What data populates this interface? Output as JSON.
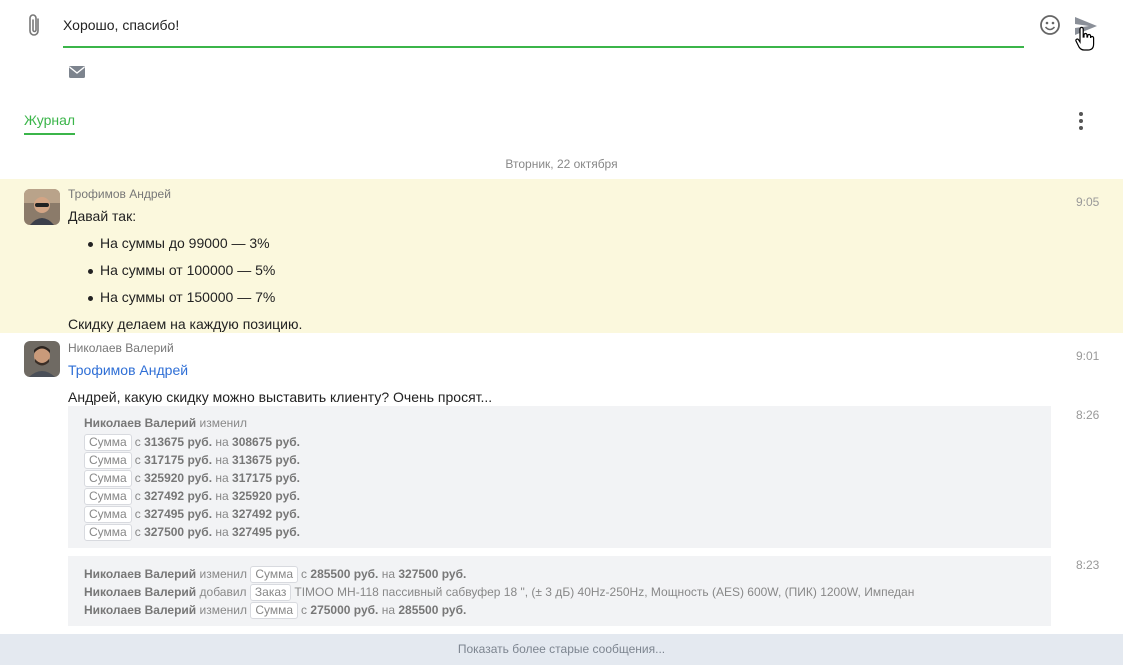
{
  "composer": {
    "input_value": "Хорошо, спасибо!",
    "attach_icon": "paperclip-icon",
    "emoji_icon": "smiley-icon",
    "send_icon": "send-icon",
    "mail_icon": "envelope-icon",
    "accent_color": "#3bb54a"
  },
  "tabs": {
    "journal": "Журнал",
    "more_icon": "kebab-menu-icon"
  },
  "date_separator": "Вторник, 22 октября",
  "messages": [
    {
      "author": "Трофимов Андрей",
      "time": "9:05",
      "intro": "Давай так:",
      "bullets": [
        "На суммы до 99000 — 3%",
        "На суммы от 100000 — 5%",
        "На суммы от 150000 — 7%"
      ],
      "outro": "Скидку делаем на каждую позицию.",
      "highlight_color": "#fbf8dd"
    },
    {
      "author": "Николаев Валерий",
      "time": "9:01",
      "mention": "Трофимов Андрей",
      "text": "Андрей, какую скидку можно выставить клиенту? Очень просят..."
    }
  ],
  "history": [
    {
      "time": "8:26",
      "header_author": "Николаев Валерий",
      "header_action": "изменил",
      "rows": [
        {
          "tag": "Сумма",
          "from_word": "с",
          "from": "313675 руб.",
          "to_word": "на",
          "to": "308675 руб."
        },
        {
          "tag": "Сумма",
          "from_word": "с",
          "from": "317175 руб.",
          "to_word": "на",
          "to": "313675 руб."
        },
        {
          "tag": "Сумма",
          "from_word": "с",
          "from": "325920 руб.",
          "to_word": "на",
          "to": "317175 руб."
        },
        {
          "tag": "Сумма",
          "from_word": "с",
          "from": "327492 руб.",
          "to_word": "на",
          "to": "325920 руб."
        },
        {
          "tag": "Сумма",
          "from_word": "с",
          "from": "327495 руб.",
          "to_word": "на",
          "to": "327492 руб."
        },
        {
          "tag": "Сумма",
          "from_word": "с",
          "from": "327500 руб.",
          "to_word": "на",
          "to": "327495 руб."
        }
      ]
    },
    {
      "time": "8:23",
      "rows": [
        {
          "author": "Николаев Валерий",
          "action": "изменил",
          "tag": "Сумма",
          "from_word": "с",
          "from": "285500 руб.",
          "to_word": "на",
          "to": "327500 руб."
        },
        {
          "author": "Николаев Валерий",
          "action": "добавил",
          "tag": "Заказ",
          "detail": "TIMOO MH-118 пассивный сабвуфер 18 \", (± 3 дБ) 40Hz-250Hz, Мощность (AES) 600W, (ПИК) 1200W, Импедан"
        },
        {
          "author": "Николаев Валерий",
          "action": "изменил",
          "tag": "Сумма",
          "from_word": "с",
          "from": "275000 руб.",
          "to_word": "на",
          "to": "285500 руб."
        }
      ]
    }
  ],
  "footer": {
    "show_older": "Показать более старые сообщения..."
  }
}
